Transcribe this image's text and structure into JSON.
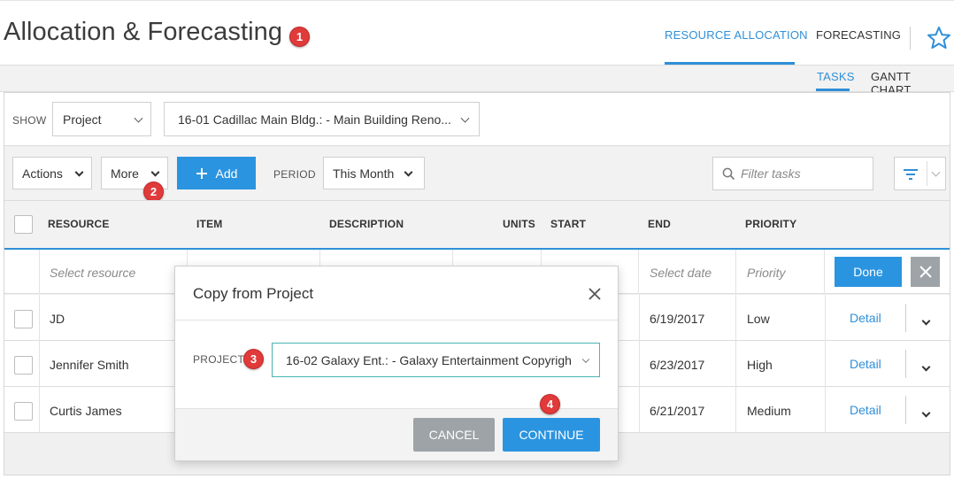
{
  "header": {
    "title": "Allocation & Forecasting",
    "tabs": [
      {
        "label": "RESOURCE ALLOCATION",
        "active": true
      },
      {
        "label": "FORECASTING",
        "active": false
      }
    ],
    "star_icon": "star-icon"
  },
  "subnav": {
    "tabs": [
      {
        "label": "TASKS",
        "active": true
      },
      {
        "label": "GANTT CHART",
        "active": false
      }
    ]
  },
  "filters": {
    "show_label": "SHOW",
    "show_value": "Project",
    "project_value": "16-01 Cadillac Main Bldg.: - Main Building Reno..."
  },
  "toolbar": {
    "actions_label": "Actions",
    "more_label": "More",
    "add_label": "Add",
    "period_label": "PERIOD",
    "period_value": "This Month",
    "filter_placeholder": "Filter tasks"
  },
  "table": {
    "columns": [
      "RESOURCE",
      "ITEM",
      "DESCRIPTION",
      "UNITS",
      "START",
      "END",
      "PRIORITY"
    ],
    "edit_row": {
      "resource_placeholder": "Select resource",
      "date_placeholder": "Select date",
      "priority_placeholder": "Priority",
      "done_label": "Done"
    },
    "rows": [
      {
        "resource": "JD",
        "end": "6/19/2017",
        "priority": "Low",
        "action": "Detail"
      },
      {
        "resource": "Jennifer Smith",
        "end": "6/23/2017",
        "priority": "High",
        "action": "Detail"
      },
      {
        "resource": "Curtis James",
        "end": "6/21/2017",
        "priority": "Medium",
        "action": "Detail"
      }
    ]
  },
  "modal": {
    "title": "Copy from Project",
    "project_label": "PROJECT",
    "project_value": "16-02 Galaxy Ent.: - Galaxy Entertainment Copyrigh",
    "cancel_label": "CANCEL",
    "continue_label": "CONTINUE"
  },
  "callouts": [
    "1",
    "2",
    "3",
    "4"
  ],
  "colors": {
    "accent": "#2f8fd8",
    "button_blue": "#2b94e0",
    "badge_red": "#e03a3a",
    "cancel_gray": "#9ea3a8"
  }
}
